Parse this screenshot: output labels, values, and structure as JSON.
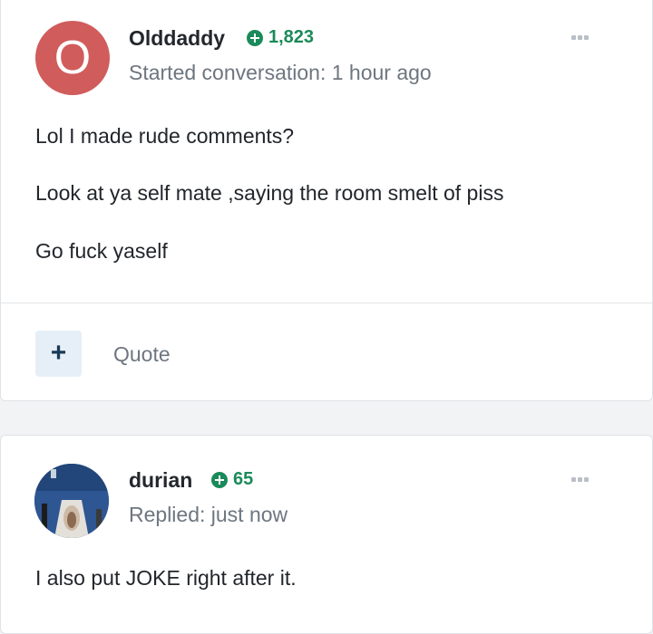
{
  "posts": [
    {
      "author": "Olddaddy",
      "avatar_letter": "O",
      "reputation": "1,823",
      "meta": "Started conversation: 1 hour ago",
      "paragraphs": [
        "Lol I made rude comments?",
        "Look at ya self mate ,saying the room smelt of piss",
        "Go fuck yaself"
      ],
      "actions": {
        "plus_label": "+",
        "quote_label": "Quote"
      }
    },
    {
      "author": "durian",
      "reputation": "65",
      "meta": "Replied: just now",
      "paragraphs": [
        "I also put JOKE right after it."
      ]
    }
  ],
  "colors": {
    "avatar_bg": "#d05c5c",
    "reputation_green": "#1b8a5a",
    "muted_text": "#6d7680"
  },
  "icons": [
    "plus-circle-icon",
    "more-options-icon"
  ]
}
